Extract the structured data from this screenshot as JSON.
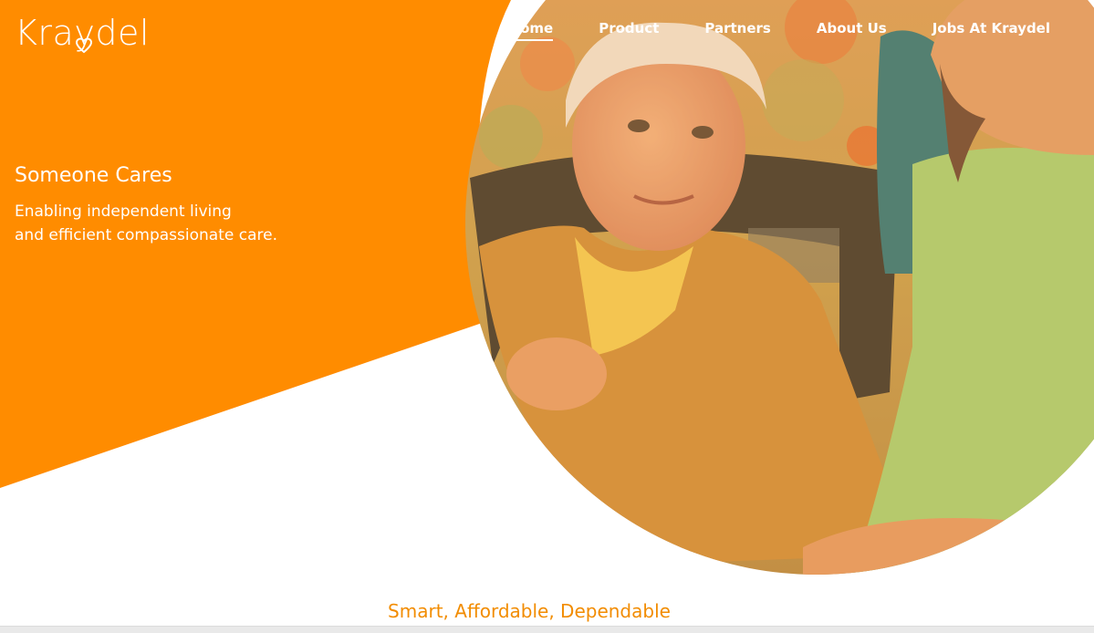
{
  "brand": {
    "name": "Kraydel",
    "accent": "#ff8c00",
    "tagline_color": "#f28c00"
  },
  "nav": {
    "items": [
      {
        "label": "Home",
        "active": true
      },
      {
        "label": "Product",
        "active": false
      },
      {
        "label": "Partners",
        "active": false
      },
      {
        "label": "About Us",
        "active": false
      },
      {
        "label": "Jobs At Kraydel",
        "active": false
      }
    ]
  },
  "hero": {
    "title": "Someone Cares",
    "subtitle_line1": "Enabling independent living",
    "subtitle_line2": "and efficient compassionate care.",
    "image": "elderly-woman-with-caregiver-photo"
  },
  "section": {
    "tagline": "Smart, Affordable, Dependable"
  }
}
